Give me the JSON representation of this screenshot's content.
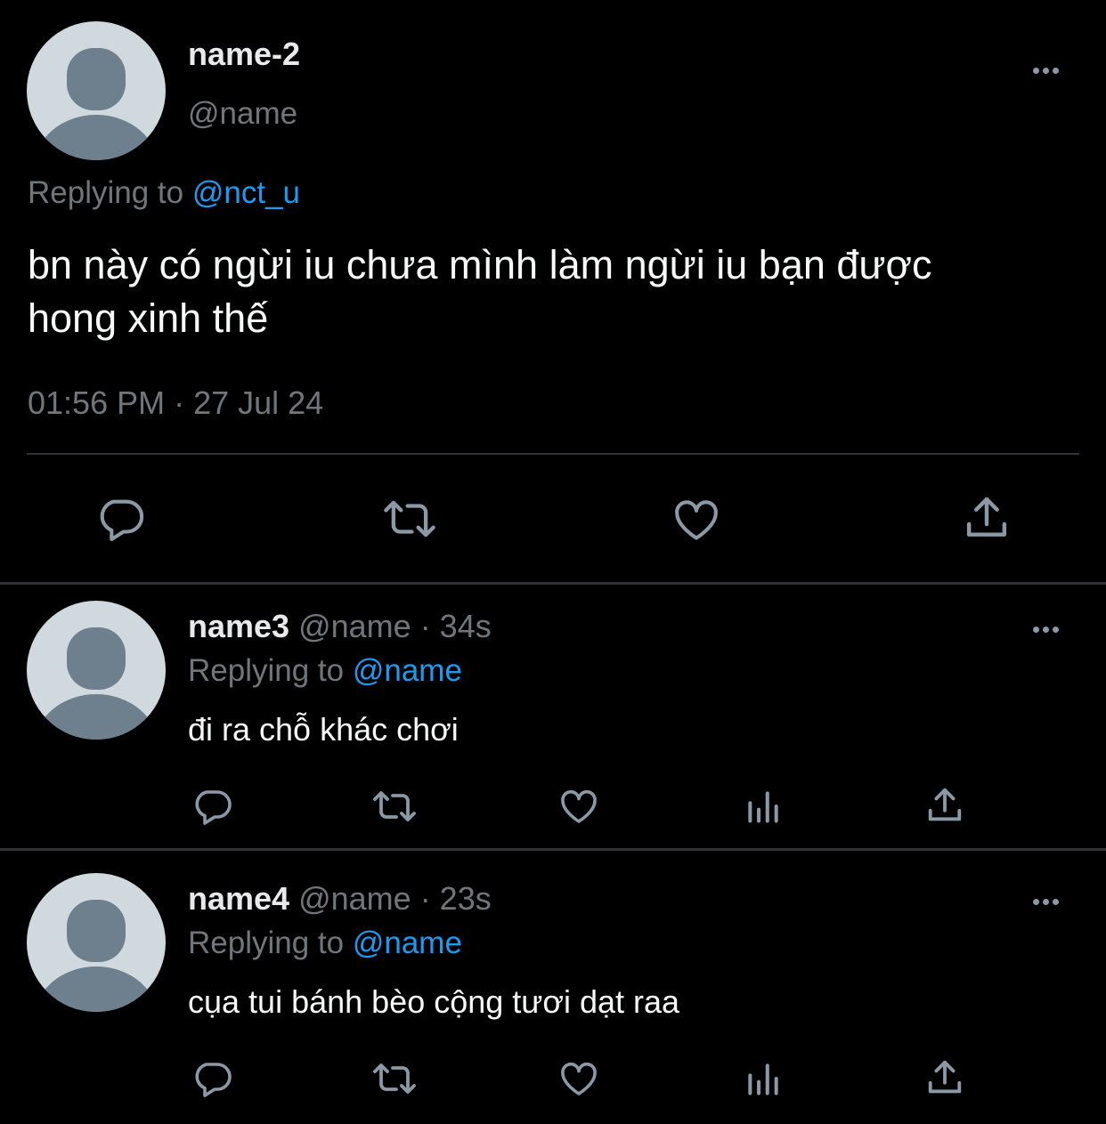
{
  "main_tweet": {
    "display_name": "name-2",
    "handle": "@name",
    "replying_label": "Replying to",
    "replying_to": "@nct_u",
    "text_line1": "bn này có ngừi iu chưa mình làm ngừi iu bạn được",
    "text_line2": "hong xinh thế",
    "timestamp": "01:56 PM · 27 Jul 24",
    "actions": [
      "reply-icon",
      "retweet-icon",
      "like-icon",
      "share-icon"
    ]
  },
  "replies": [
    {
      "display_name": "name3",
      "handle_time": "@name · 34s",
      "replying_label": "Replying to",
      "replying_to": "@name",
      "text": "đi ra chỗ khác chơi",
      "actions": [
        "reply-icon",
        "retweet-icon",
        "like-icon",
        "analytics-icon",
        "share-icon"
      ]
    },
    {
      "display_name": "name4",
      "handle_time": "@name · 23s",
      "replying_label": "Replying to",
      "replying_to": "@name",
      "text": "cụa tui bánh bèo cộng tươi dạt raa",
      "actions": [
        "reply-icon",
        "retweet-icon",
        "like-icon",
        "analytics-icon",
        "share-icon"
      ]
    }
  ],
  "colors": {
    "background": "#000000",
    "text": "#e7e9ea",
    "muted": "#71767b",
    "link": "#1d9bf0",
    "avatar_bg": "#cfd9de",
    "avatar_figure": "#6e7f8e"
  }
}
